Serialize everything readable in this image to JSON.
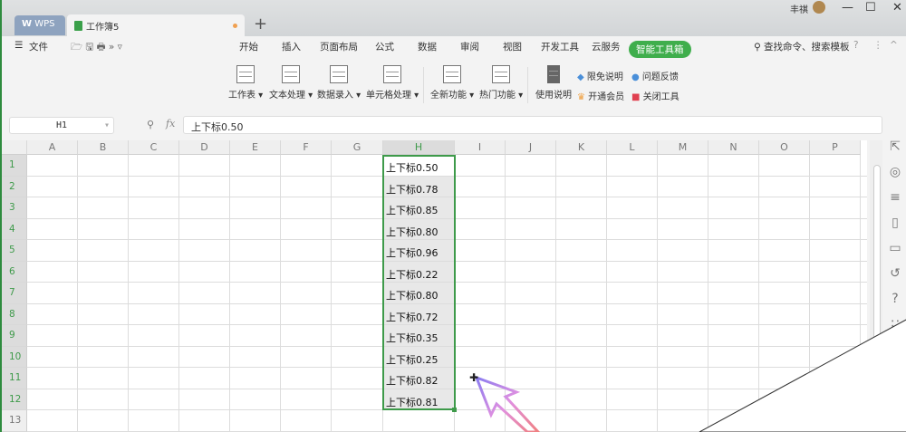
{
  "titlebar": {
    "wps_tab": "WPS",
    "doc_tab": "工作簿5",
    "new_tab": "+",
    "user": "丰祺",
    "minimize": "—",
    "maximize": "☐",
    "close": "✕"
  },
  "menu": {
    "file": "文件",
    "tabs": [
      "开始",
      "插入",
      "页面布局",
      "公式",
      "数据",
      "审阅",
      "视图",
      "开发工具",
      "云服务"
    ],
    "active_tab": "智能工具箱",
    "search": "查找命令、搜索模板",
    "help": "?",
    "more": "⋮",
    "collapse": "^"
  },
  "ribbon": {
    "buttons": [
      "工作表",
      "文本处理",
      "数据录入",
      "单元格处理",
      "全新功能",
      "热门功能",
      "使用说明"
    ],
    "links": [
      "限免说明",
      "问题反馈",
      "开通会员",
      "关闭工具"
    ]
  },
  "formula": {
    "name_box": "H1",
    "fx": "fx",
    "value": "上下标0.50"
  },
  "columns": [
    "A",
    "B",
    "C",
    "D",
    "E",
    "F",
    "G",
    "H",
    "I",
    "J",
    "K",
    "L",
    "M",
    "N",
    "O",
    "P"
  ],
  "rows": [
    "1",
    "2",
    "3",
    "4",
    "5",
    "6",
    "7",
    "8",
    "9",
    "10",
    "11",
    "12",
    "13"
  ],
  "h_values": [
    "上下标0.50",
    "上下标0.78",
    "上下标0.85",
    "上下标0.80",
    "上下标0.96",
    "上下标0.22",
    "上下标0.80",
    "上下标0.72",
    "上下标0.35",
    "上下标0.25",
    "上下标0.82",
    "上下标0.81"
  ],
  "colors": {
    "accent": "#3fae4c",
    "selection": "#3e9a4a"
  }
}
